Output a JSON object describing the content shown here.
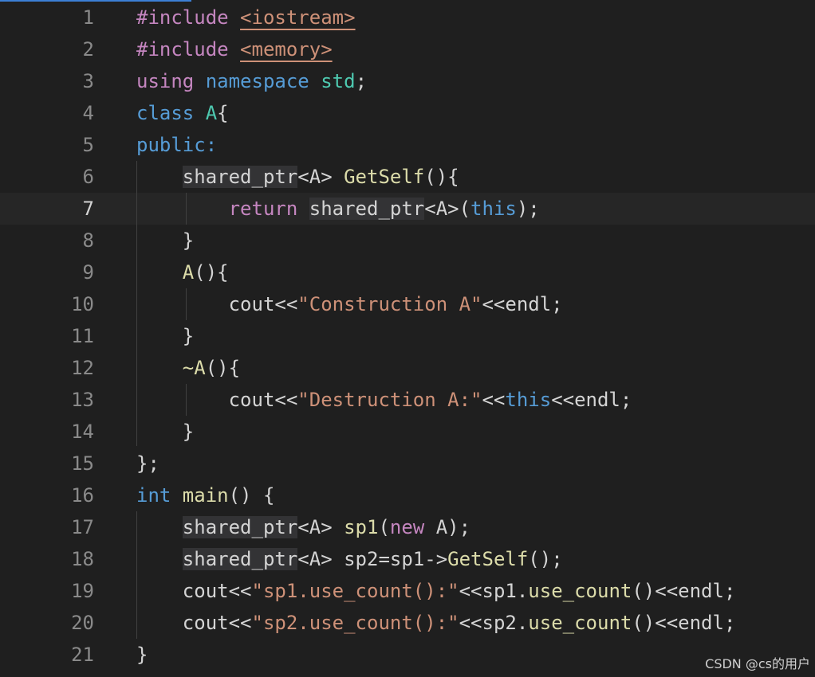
{
  "lines": [
    {
      "num": "1",
      "tokens": [
        {
          "t": "#include ",
          "c": "kw"
        },
        {
          "t": "<iostream>",
          "c": "st ul"
        }
      ]
    },
    {
      "num": "2",
      "tokens": [
        {
          "t": "#include ",
          "c": "kw"
        },
        {
          "t": "<memory>",
          "c": "st ul"
        }
      ]
    },
    {
      "num": "3",
      "tokens": [
        {
          "t": "using ",
          "c": "kw"
        },
        {
          "t": "namespace ",
          "c": "bl"
        },
        {
          "t": "std",
          "c": "ty"
        },
        {
          "t": ";",
          "c": ""
        }
      ]
    },
    {
      "num": "4",
      "tokens": [
        {
          "t": "class ",
          "c": "bl"
        },
        {
          "t": "A",
          "c": "ty"
        },
        {
          "t": "{",
          "c": ""
        }
      ]
    },
    {
      "num": "5",
      "tokens": [
        {
          "t": "public:",
          "c": "bl"
        }
      ]
    },
    {
      "num": "6",
      "tokens": [
        {
          "t": "    ",
          "c": ""
        },
        {
          "t": "shared_ptr",
          "c": "hl"
        },
        {
          "t": "<A> ",
          "c": ""
        },
        {
          "t": "GetSelf",
          "c": "fn"
        },
        {
          "t": "(){",
          "c": ""
        }
      ]
    },
    {
      "num": "7",
      "tokens": [
        {
          "t": "        ",
          "c": ""
        },
        {
          "t": "return ",
          "c": "kw"
        },
        {
          "t": "shared_ptr",
          "c": "hl"
        },
        {
          "t": "<A>(",
          "c": ""
        },
        {
          "t": "this",
          "c": "bl"
        },
        {
          "t": ");",
          "c": ""
        }
      ]
    },
    {
      "num": "8",
      "tokens": [
        {
          "t": "    }",
          "c": ""
        }
      ]
    },
    {
      "num": "9",
      "tokens": [
        {
          "t": "    ",
          "c": ""
        },
        {
          "t": "A",
          "c": "fn"
        },
        {
          "t": "(){",
          "c": ""
        }
      ]
    },
    {
      "num": "10",
      "tokens": [
        {
          "t": "        cout<<",
          "c": ""
        },
        {
          "t": "\"Construction A\"",
          "c": "st"
        },
        {
          "t": "<<endl;",
          "c": ""
        }
      ]
    },
    {
      "num": "11",
      "tokens": [
        {
          "t": "    }",
          "c": ""
        }
      ]
    },
    {
      "num": "12",
      "tokens": [
        {
          "t": "    ",
          "c": ""
        },
        {
          "t": "~A",
          "c": "fn"
        },
        {
          "t": "(){",
          "c": ""
        }
      ]
    },
    {
      "num": "13",
      "tokens": [
        {
          "t": "        cout<<",
          "c": ""
        },
        {
          "t": "\"Destruction A:\"",
          "c": "st"
        },
        {
          "t": "<<",
          "c": ""
        },
        {
          "t": "this",
          "c": "bl"
        },
        {
          "t": "<<endl;",
          "c": ""
        }
      ]
    },
    {
      "num": "14",
      "tokens": [
        {
          "t": "    }",
          "c": ""
        }
      ]
    },
    {
      "num": "15",
      "tokens": [
        {
          "t": "};",
          "c": ""
        }
      ]
    },
    {
      "num": "16",
      "tokens": [
        {
          "t": "int ",
          "c": "bl"
        },
        {
          "t": "main",
          "c": "fn"
        },
        {
          "t": "() {",
          "c": ""
        }
      ]
    },
    {
      "num": "17",
      "tokens": [
        {
          "t": "    ",
          "c": ""
        },
        {
          "t": "shared_ptr",
          "c": "hl"
        },
        {
          "t": "<A> ",
          "c": ""
        },
        {
          "t": "sp1",
          "c": "fn"
        },
        {
          "t": "(",
          "c": ""
        },
        {
          "t": "new ",
          "c": "kw"
        },
        {
          "t": "A);",
          "c": ""
        }
      ]
    },
    {
      "num": "18",
      "tokens": [
        {
          "t": "    ",
          "c": ""
        },
        {
          "t": "shared_ptr",
          "c": "hl"
        },
        {
          "t": "<A> sp2=sp1->",
          "c": ""
        },
        {
          "t": "GetSelf",
          "c": "fn"
        },
        {
          "t": "();",
          "c": ""
        }
      ]
    },
    {
      "num": "19",
      "tokens": [
        {
          "t": "    cout<<",
          "c": ""
        },
        {
          "t": "\"sp1.use_count():\"",
          "c": "st"
        },
        {
          "t": "<<sp1.",
          "c": ""
        },
        {
          "t": "use_count",
          "c": "fn"
        },
        {
          "t": "()<<endl;",
          "c": ""
        }
      ]
    },
    {
      "num": "20",
      "tokens": [
        {
          "t": "    cout<<",
          "c": ""
        },
        {
          "t": "\"sp2.use_count():\"",
          "c": "st"
        },
        {
          "t": "<<sp2.",
          "c": ""
        },
        {
          "t": "use_count",
          "c": "fn"
        },
        {
          "t": "()<<endl;",
          "c": ""
        }
      ]
    },
    {
      "num": "21",
      "tokens": [
        {
          "t": "}",
          "c": ""
        }
      ]
    }
  ],
  "active_line": "7",
  "watermark": "CSDN @cs的用户"
}
